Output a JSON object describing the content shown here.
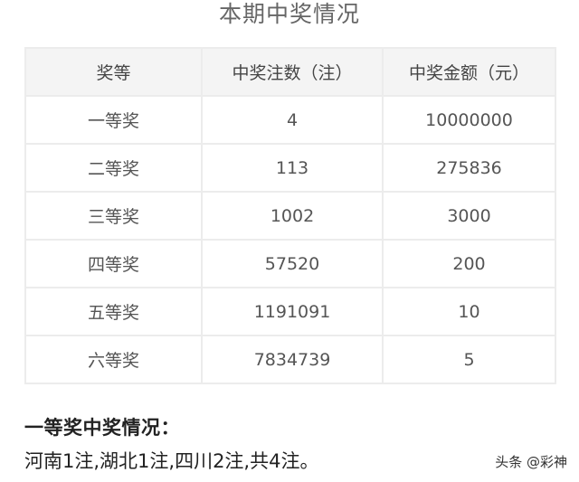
{
  "title": "本期中奖情况",
  "table": {
    "headers": [
      "奖等",
      "中奖注数（注）",
      "中奖金额（元）"
    ],
    "rows": [
      {
        "level": "一等奖",
        "count": "4",
        "amount": "10000000"
      },
      {
        "level": "二等奖",
        "count": "113",
        "amount": "275836"
      },
      {
        "level": "三等奖",
        "count": "1002",
        "amount": "3000"
      },
      {
        "level": "四等奖",
        "count": "57520",
        "amount": "200"
      },
      {
        "level": "五等奖",
        "count": "1191091",
        "amount": "10"
      },
      {
        "level": "六等奖",
        "count": "7834739",
        "amount": "5"
      }
    ]
  },
  "first_prize": {
    "heading": "一等奖中奖情况：",
    "detail": "河南1注,湖北1注,四川2注,共4注。"
  },
  "watermark": "头条 @彩神"
}
